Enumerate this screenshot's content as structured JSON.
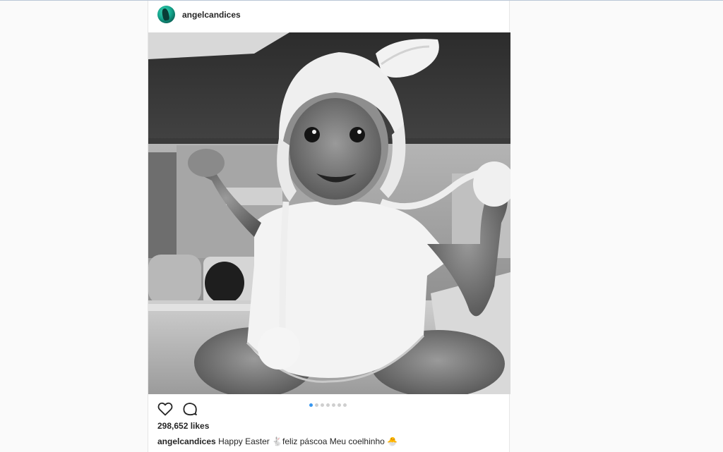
{
  "post": {
    "username": "angelcandices",
    "likes": "298,652 likes",
    "caption": {
      "user": "angelcandices",
      "text": "Happy Easter 🐇feliz páscoa Meu coelhinho 🐣"
    },
    "carousel": {
      "count": 7,
      "active_index": 0
    }
  },
  "icons": {
    "like": "heart-icon",
    "comment": "comment-icon"
  },
  "colors": {
    "active_dot": "#3897f0",
    "inactive_dot": "#cfcfcf",
    "text": "#262626"
  }
}
